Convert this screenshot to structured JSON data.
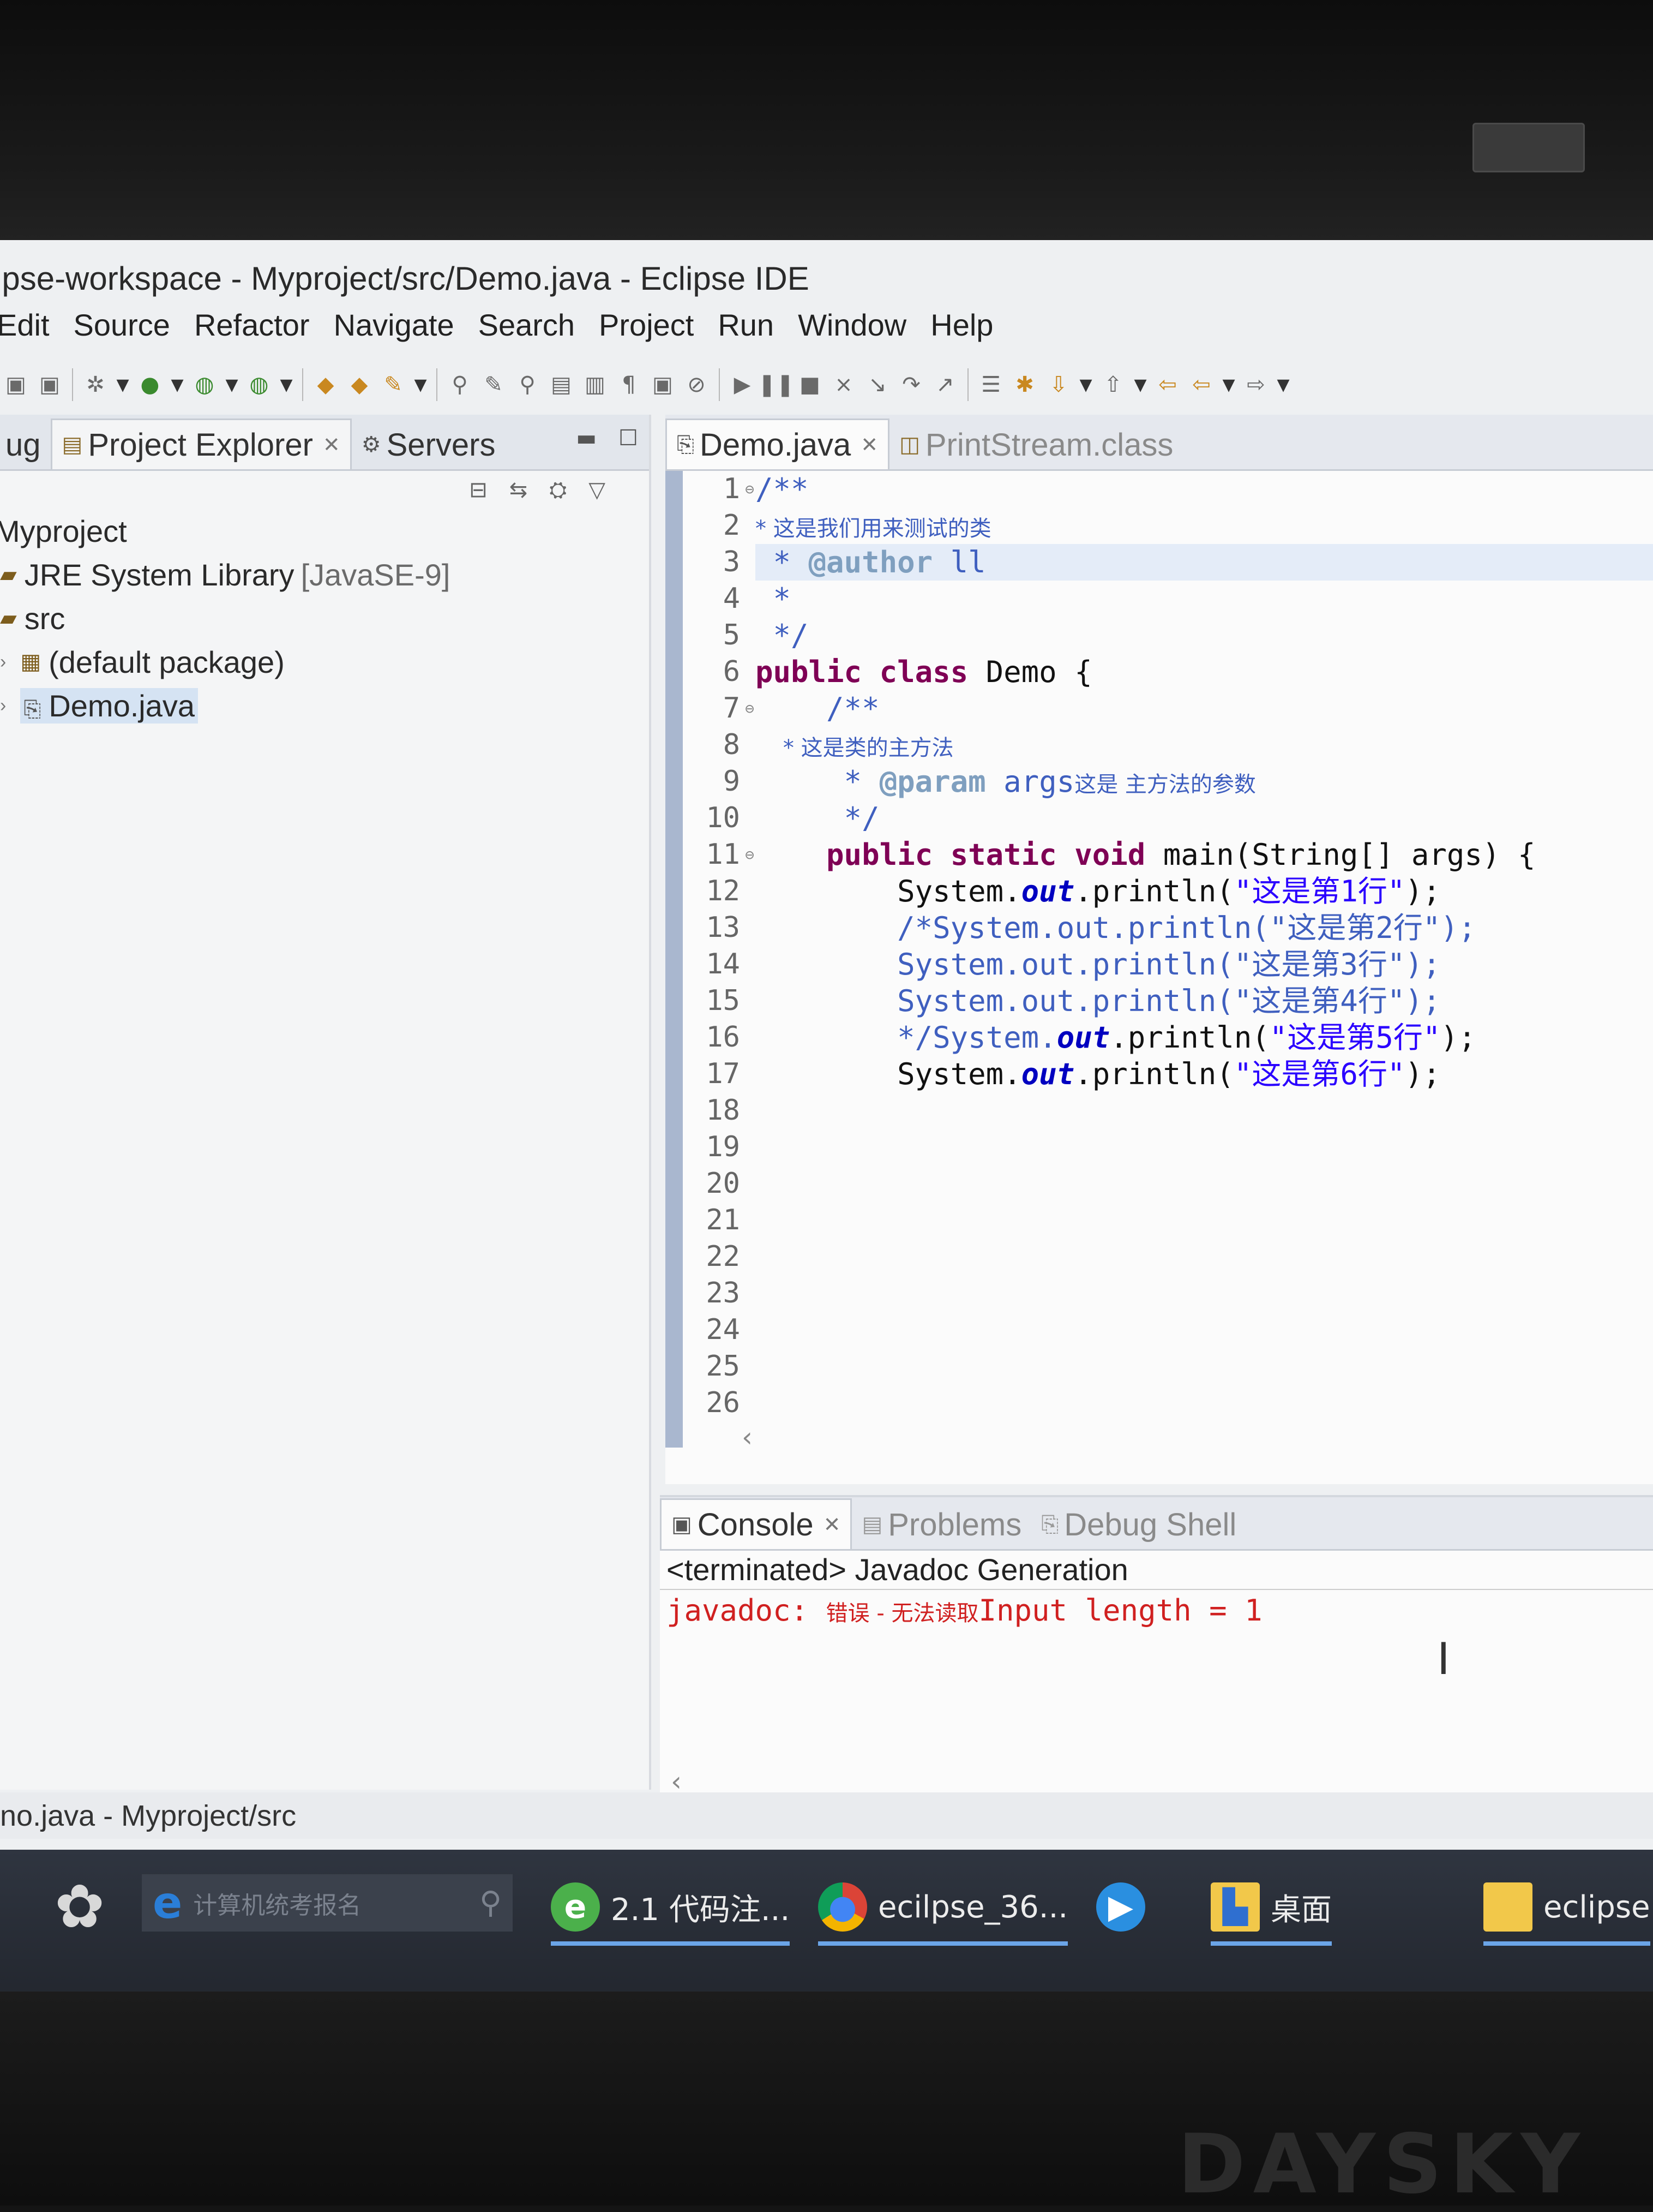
{
  "window": {
    "title": "ipse-workspace - Myproject/src/Demo.java - Eclipse IDE"
  },
  "menu": [
    "Edit",
    "Source",
    "Refactor",
    "Navigate",
    "Search",
    "Project",
    "Run",
    "Window",
    "Help"
  ],
  "left_panel": {
    "tabs": [
      {
        "label": "ug",
        "icon": "debug-icon"
      },
      {
        "label": "Project Explorer",
        "icon": "project-explorer-icon"
      },
      {
        "label": "Servers",
        "icon": "servers-icon"
      }
    ],
    "tree": {
      "project": "Myproject",
      "jre": "JRE System Library",
      "jre_version": "[JavaSE-9]",
      "src": "src",
      "package": "(default package)",
      "file": "Demo.java"
    }
  },
  "editor": {
    "tabs": [
      {
        "label": "Demo.java",
        "active": true,
        "icon": "java-file-icon"
      },
      {
        "label": "PrintStream.class",
        "active": false,
        "icon": "class-file-icon"
      }
    ],
    "line_numbers": [
      "1",
      "2",
      "3",
      "4",
      "5",
      "6",
      "7",
      "8",
      "9",
      "10",
      "11",
      "12",
      "13",
      "14",
      "15",
      "16",
      "17",
      "18",
      "19",
      "20",
      "21",
      "22",
      "23",
      "24",
      "25",
      "26"
    ],
    "code": {
      "l1": "/**",
      "l2": "* 这是我们用来测试的类",
      "l3_star": " * ",
      "l3_tag": "@author",
      "l3_name": " ll",
      "l4": " *",
      "l5": " */",
      "l6_kw": "public class",
      "l6_rest": " Demo {",
      "l7": "    /**",
      "l8": "    * 这是类的主方法",
      "l9_star": "     * ",
      "l9_tag": "@param",
      "l9_arg": " args",
      "l9_desc": "这是 主方法的参数",
      "l10": "     */",
      "l11_kw": "public static void",
      "l11_rest": " main(String[] args) {",
      "l12_a": "System.",
      "l12_out": "out",
      "l12_b": ".println(",
      "l12_str": "\"这是第1行\"",
      "l12_c": ");",
      "l13": "/*System.out.println(\"这是第2行\");",
      "l14": "System.out.println(\"这是第3行\");",
      "l15": "System.out.println(\"这是第4行\");",
      "l16_a": "*/System.",
      "l16_out": "out",
      "l16_b": ".println(",
      "l16_str": "\"这是第5行\"",
      "l16_c": ");",
      "l17_a": "System.",
      "l17_out": "out",
      "l17_b": ".println(",
      "l17_str": "\"这是第6行\"",
      "l17_c": ");"
    }
  },
  "console": {
    "tabs": [
      {
        "label": "Console",
        "active": true
      },
      {
        "label": "Problems",
        "active": false
      },
      {
        "label": "Debug Shell",
        "active": false
      }
    ],
    "status": "<terminated> Javadoc Generation",
    "output_prefix": "javadoc: ",
    "output_zh": "错误 - 无法读取",
    "output_rest": "Input length = 1"
  },
  "statusbar": {
    "text": "no.java - Myproject/src"
  },
  "taskbar": {
    "search_placeholder": "计算机统考报名",
    "tasks": [
      {
        "label": "2.1 代码注...",
        "icon": "browser-e-icon"
      },
      {
        "label": "ecilpse_36...",
        "icon": "chrome-icon"
      },
      {
        "label": "",
        "icon": "media-player-icon"
      },
      {
        "label": "桌面",
        "icon": "folder-icon"
      },
      {
        "label": "eclipse",
        "icon": "folder-icon"
      }
    ]
  },
  "monitor_brand": "DAYSKY",
  "colors": {
    "keyword": "#7f0055",
    "comment": "#3f5fbf",
    "string": "#2a00ff",
    "field": "#0000c0",
    "error": "#d02020"
  }
}
